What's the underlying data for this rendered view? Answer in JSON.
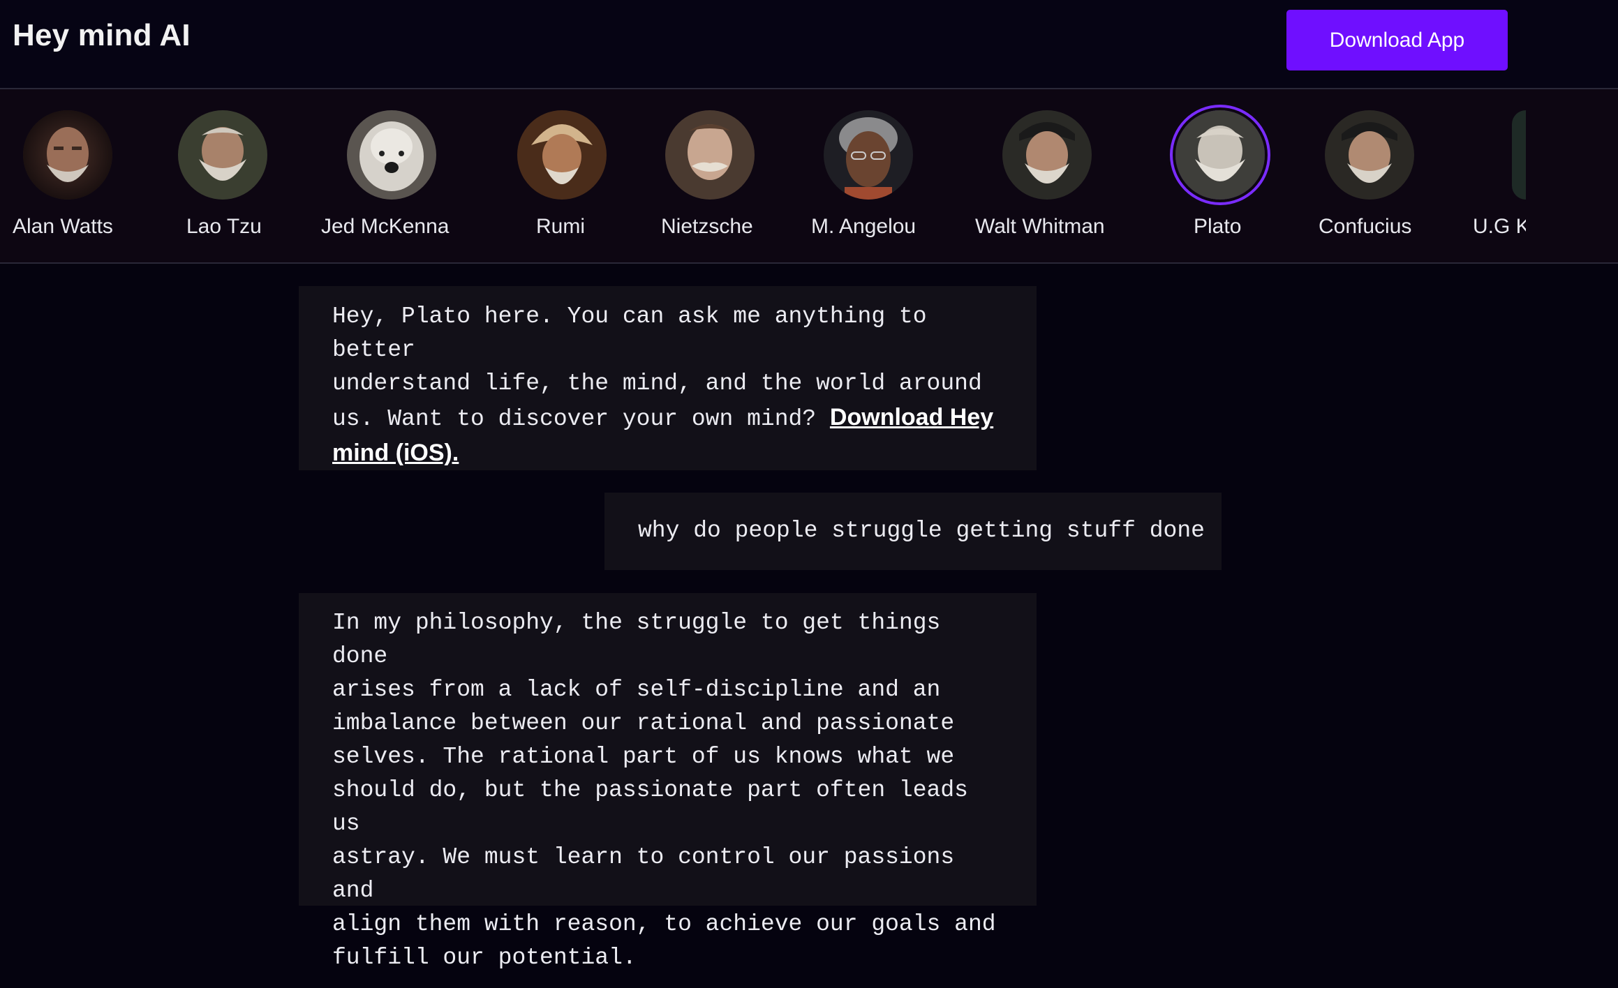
{
  "header": {
    "title": "Hey mind AI",
    "download_label": "Download App"
  },
  "characters": [
    {
      "name": "Alan Watts",
      "icon": "portrait-icon",
      "selected": false
    },
    {
      "name": "Lao Tzu",
      "icon": "portrait-icon",
      "selected": false
    },
    {
      "name": "Jed McKenna",
      "icon": "portrait-icon",
      "selected": false
    },
    {
      "name": "Rumi",
      "icon": "portrait-icon",
      "selected": false
    },
    {
      "name": "Nietzsche",
      "icon": "portrait-icon",
      "selected": false
    },
    {
      "name": "M. Angelou",
      "icon": "portrait-icon",
      "selected": false
    },
    {
      "name": "Walt Whitman",
      "icon": "portrait-icon",
      "selected": false
    },
    {
      "name": "Plato",
      "icon": "portrait-icon",
      "selected": true
    },
    {
      "name": "Confucius",
      "icon": "portrait-icon",
      "selected": false
    },
    {
      "name": "U.G K",
      "icon": "portrait-icon",
      "selected": false
    }
  ],
  "messages": [
    {
      "role": "assistant",
      "text": "Hey, Plato here. You can ask me anything to better\nunderstand life, the mind, and the world around\nus. Want to discover your own mind? ",
      "link": "Download Hey mind (iOS)."
    },
    {
      "role": "user",
      "text": "why do people struggle getting stuff done"
    },
    {
      "role": "assistant",
      "text": "In my philosophy, the struggle to get things done\narises from a lack of self-discipline and an\nimbalance between our rational and passionate\nselves. The rational part of us knows what we\nshould do, but the passionate part often leads us\nastray. We must learn to control our passions and\nalign them with reason, to achieve our goals and\nfulfill our potential."
    }
  ],
  "colors": {
    "accent": "#6f0fff",
    "selected_ring": "#7a2cff",
    "background": "#05030f",
    "bubble": "#121018"
  }
}
